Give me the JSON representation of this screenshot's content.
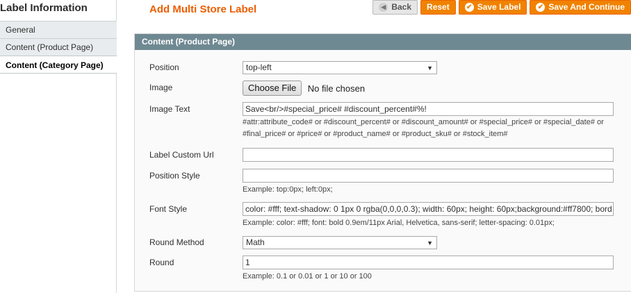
{
  "sidebar": {
    "title": "Label Information",
    "tabs": [
      {
        "label": "General"
      },
      {
        "label": "Content (Product Page)"
      },
      {
        "label": "Content (Category Page)"
      }
    ]
  },
  "header": {
    "title": "Add Multi Store Label",
    "buttons": {
      "back": "Back",
      "reset": "Reset",
      "save": "Save Label",
      "save_continue": "Save And Continue"
    }
  },
  "fieldset": {
    "title": "Content (Product Page)",
    "position": {
      "label": "Position",
      "value": "top-left"
    },
    "image": {
      "label": "Image",
      "button": "Choose File",
      "status": "No file chosen"
    },
    "image_text": {
      "label": "Image Text",
      "value": "Save<br/>#special_price# #discount_percent#%!",
      "note_line1": "#attr:attribute_code# or #discount_percent# or #discount_amount# or #special_price# or #special_date# or",
      "note_line2": "#final_price# or #price# or #product_name# or #product_sku# or #stock_item#"
    },
    "custom_url": {
      "label": "Label Custom Url",
      "value": ""
    },
    "position_style": {
      "label": "Position Style",
      "value": "",
      "note": "Example: top:0px; left:0px;"
    },
    "font_style": {
      "label": "Font Style",
      "value": "color: #fff; text-shadow: 0 1px 0 rgba(0,0,0,0.3); width: 60px; height: 60px;background:#ff7800; bord",
      "note": "Example: color: #fff; font: bold 0.9em/11px Arial, Helvetica, sans-serif; letter-spacing: 0.01px;"
    },
    "round_method": {
      "label": "Round Method",
      "value": "Math"
    },
    "round": {
      "label": "Round",
      "value": "1",
      "note": "Example: 0.1 or 0.01 or 1 or 10 or 100"
    }
  },
  "colors": {
    "accent": "#eb5e00",
    "button": "#f18200",
    "section_header": "#6f8992"
  }
}
